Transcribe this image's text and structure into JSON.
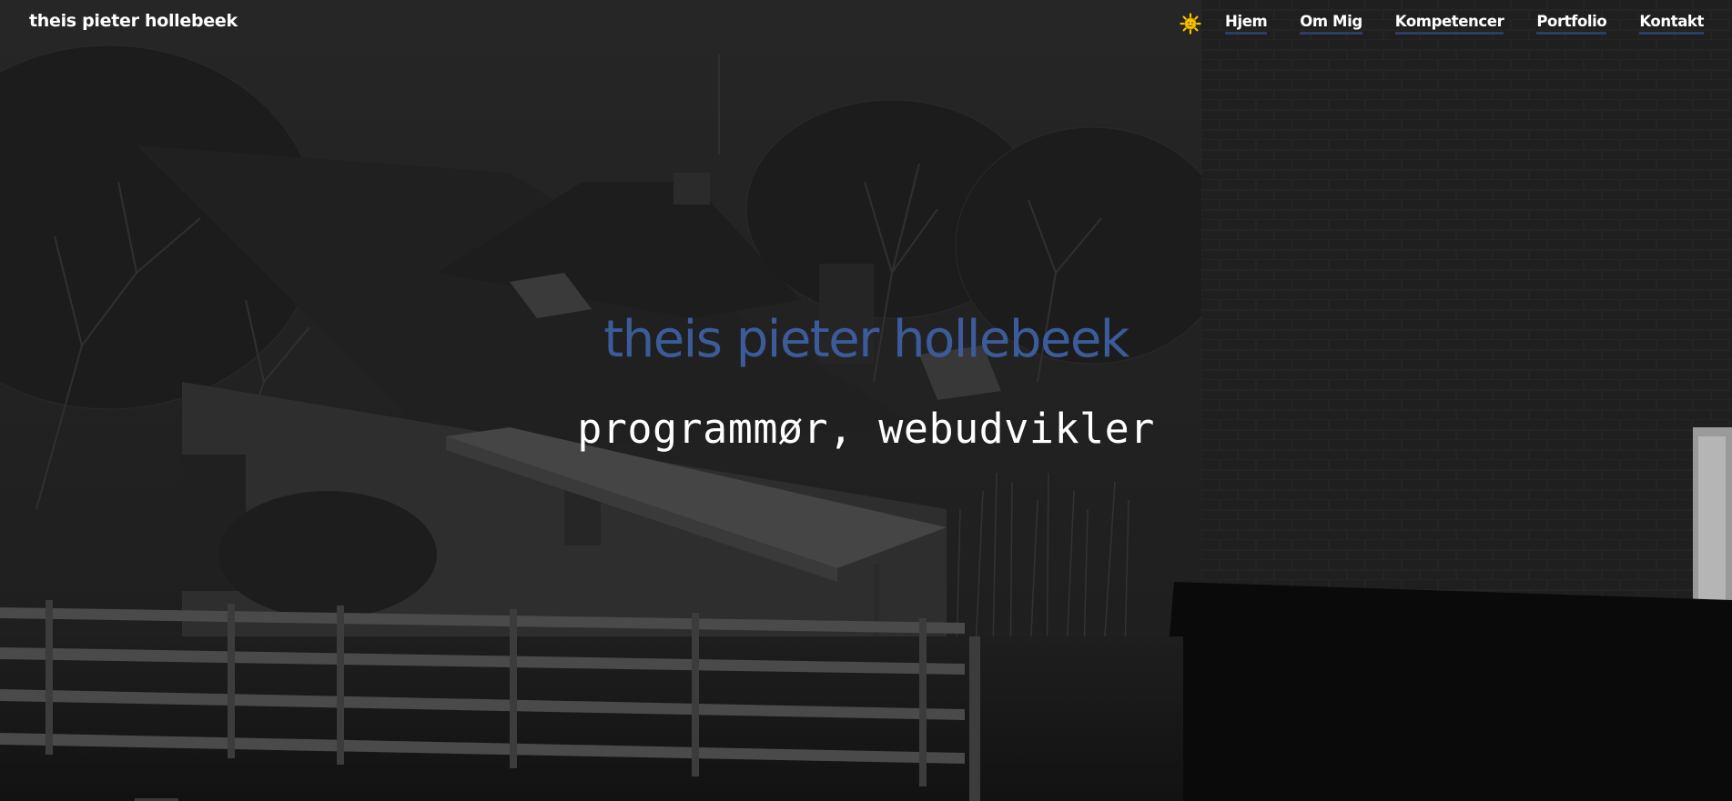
{
  "site": {
    "brand": "theis pieter hollebeek"
  },
  "nav": {
    "theme_icon": "sun-icon",
    "items": [
      {
        "label": "Hjem"
      },
      {
        "label": "Om Mig"
      },
      {
        "label": "Kompetencer"
      },
      {
        "label": "Portfolio"
      },
      {
        "label": "Kontakt"
      }
    ]
  },
  "hero": {
    "title": "theis pieter hollebeek",
    "subtitle": "programmør, webudvikler",
    "background": "darkened photo of a house, fence and trees",
    "colors": {
      "title": "#3c5b9a",
      "subtitle": "#ffffff",
      "nav_underline": "#2d3e66",
      "sun": "#f5c400"
    }
  }
}
